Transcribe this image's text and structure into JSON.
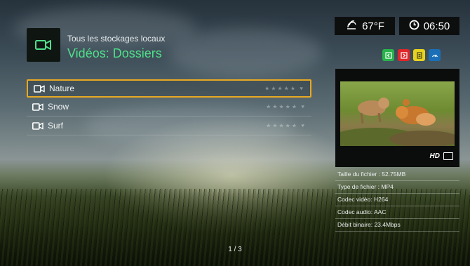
{
  "header": {
    "subtitle": "Tous les stockages locaux",
    "title": "Vidéos: Dossiers"
  },
  "status": {
    "temperature": "67°F",
    "time": "06:50",
    "weather_icon": "weather-icon",
    "clock_icon": "clock-icon"
  },
  "color_buttons": [
    {
      "name": "green-button",
      "color": "#28b34a"
    },
    {
      "name": "red-button",
      "color": "#e0262a"
    },
    {
      "name": "yellow-button",
      "color": "#e6d31e"
    },
    {
      "name": "blue-button",
      "color": "#1a6fb8"
    }
  ],
  "folders": [
    {
      "label": "Nature",
      "selected": true
    },
    {
      "label": "Snow",
      "selected": false
    },
    {
      "label": "Surf",
      "selected": false
    }
  ],
  "preview": {
    "badge": "HD"
  },
  "file_info": [
    "Taille du fichier : 52.75MB",
    "Type de fichier : MP4",
    "Codec vidéo: H264",
    "Codec audio: AAC",
    "Débit binaire: 23.4Mbps"
  ],
  "pagination": "1 / 3",
  "colors": {
    "accent_green": "#4fe08a",
    "selection": "#e8a922"
  }
}
